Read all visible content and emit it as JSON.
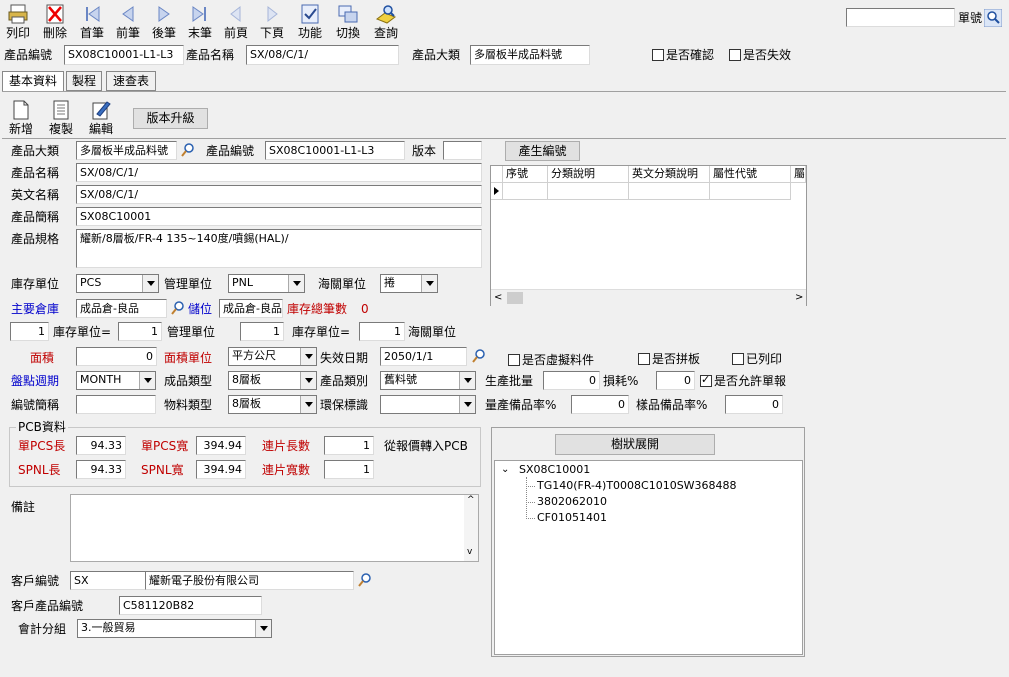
{
  "toolbar": {
    "items": [
      {
        "label": "列印",
        "icon": "printer-icon"
      },
      {
        "label": "刪除",
        "icon": "delete-icon"
      },
      {
        "label": "首筆",
        "icon": "first-record-icon"
      },
      {
        "label": "前筆",
        "icon": "prev-record-icon"
      },
      {
        "label": "後筆",
        "icon": "next-record-icon"
      },
      {
        "label": "末筆",
        "icon": "last-record-icon"
      },
      {
        "label": "前頁",
        "icon": "prev-page-icon"
      },
      {
        "label": "下頁",
        "icon": "next-page-icon"
      },
      {
        "label": "功能",
        "icon": "function-icon"
      },
      {
        "label": "切換",
        "icon": "switch-icon"
      },
      {
        "label": "查詢",
        "icon": "query-icon"
      }
    ],
    "search_value": "",
    "search_label": "單號"
  },
  "header": {
    "product_code_label": "產品編號",
    "product_code": "SX08C10001-L1-L3",
    "product_name_label": "產品名稱",
    "product_name": "SX/08/C/1/",
    "category_label": "產品大類",
    "category": "多層板半成品料號",
    "confirmed_label": "是否確認",
    "invalid_label": "是否失效"
  },
  "tabs": [
    "基本資料",
    "製程",
    "速查表"
  ],
  "actions": {
    "new": "新增",
    "copy": "複製",
    "edit": "編輯",
    "upgrade": "版本升級"
  },
  "form": {
    "category_label": "產品大類",
    "category": "多層板半成品料號",
    "code_label": "產品編號",
    "code": "SX08C10001-L1-L3",
    "version_label": "版本",
    "version": "",
    "gen_code_button": "產生編號",
    "name_label": "產品名稱",
    "name": "SX/08/C/1/",
    "en_name_label": "英文名稱",
    "en_name": "SX/08/C/1/",
    "short_label": "產品簡稱",
    "short": "SX08C10001",
    "spec_label": "產品規格",
    "spec": "耀新/8層板/FR-4 135~140度/噴錫(HAL)/",
    "stock_unit_label": "庫存單位",
    "stock_unit": "PCS",
    "mgmt_unit_label": "管理單位",
    "mgmt_unit": "PNL",
    "customs_unit_label": "海關單位",
    "customs_unit": "捲",
    "main_wh_label": "主要倉庫",
    "main_wh": "成品倉-良品",
    "location_label": "儲位",
    "location": "成品倉-良品",
    "stock_total_label": "庫存總筆數",
    "stock_total": "0",
    "conv1": "1",
    "conv1_label": "庫存單位=",
    "conv2": "1",
    "conv2_label": "管理單位",
    "conv3": "1",
    "conv3_label": "庫存單位=",
    "conv4": "1",
    "conv4_label": "海關單位",
    "area_label": "面積",
    "area": "0",
    "area_unit_label": "面積單位",
    "area_unit": "平方公尺",
    "expire_label": "失效日期",
    "expire": "2050/1/1",
    "virtual_label": "是否虛擬料件",
    "panel_label": "是否拼板",
    "printed_label": "已列印",
    "cycle_label": "盤點週期",
    "cycle": "MONTH",
    "product_type_label": "成品類型",
    "product_type": "8層板",
    "prod_category_label": "產品類別",
    "prod_category": "舊料號",
    "batch_label": "生產批量",
    "batch": "0",
    "loss_label": "損耗%",
    "loss": "0",
    "allow_label": "是否允許單報",
    "code_short_label": "編號簡稱",
    "code_short": "",
    "material_type_label": "物料類型",
    "material_type": "8層板",
    "env_label": "環保標識",
    "env": "",
    "mass_rate_label": "量產備品率%",
    "mass_rate": "0",
    "sample_rate_label": "樣品備品率%",
    "sample_rate": "0"
  },
  "grid": {
    "columns": [
      "序號",
      "分類說明",
      "英文分類說明",
      "屬性代號",
      "屬"
    ]
  },
  "pcb": {
    "title": "PCB資料",
    "pcs_len_label": "單PCS長",
    "pcs_len": "94.33",
    "pcs_wid_label": "單PCS寬",
    "pcs_wid": "394.94",
    "link_len_label": "連片長數",
    "link_len": "1",
    "quote_label": "從報價轉入PCB",
    "spnl_len_label": "SPNL長",
    "spnl_len": "94.33",
    "spnl_wid_label": "SPNL寬",
    "spnl_wid": "394.94",
    "link_wid_label": "連片寬數",
    "link_wid": "1"
  },
  "tree": {
    "button": "樹狀展開",
    "root": "SX08C10001",
    "children": [
      "TG140(FR-4)T0008C1010SW368488",
      "3802062010",
      "CF01051401"
    ]
  },
  "remarks_label": "備註",
  "remarks": "",
  "customer": {
    "code_label": "客戶編號",
    "code": "SX",
    "name": "耀新電子股份有限公司",
    "prod_code_label": "客戶產品編號",
    "prod_code": "C581120B82",
    "acct_label": "會計分組",
    "acct": "3.一般貿易"
  }
}
